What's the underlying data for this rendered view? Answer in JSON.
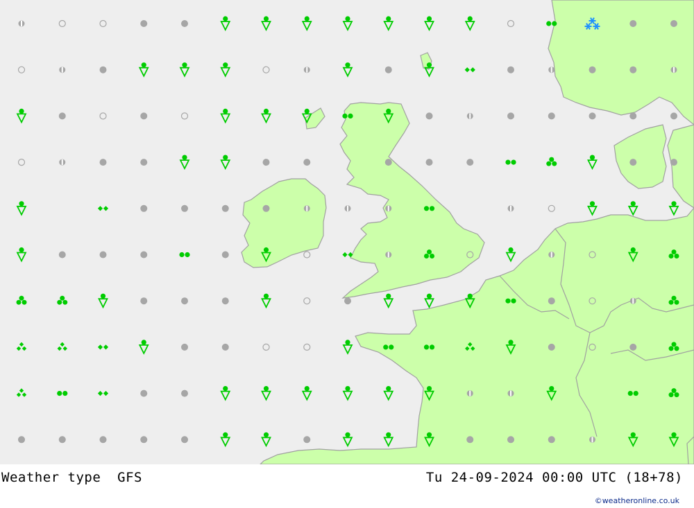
{
  "header": {
    "title": "Weather type",
    "model": "GFS",
    "datetime": "Tu 24-09-2024 00:00 UTC (18+78)",
    "credit": "©weatheronline.co.uk"
  },
  "colors": {
    "sea": "#eeeeee",
    "land": "#ccffaa",
    "coast": "#a0a0a0",
    "cloud": "#a6a6a6",
    "rain": "#00cc00",
    "snow": "#1e90ff"
  },
  "legend_symbols": {
    "clear": "empty circle",
    "partly": "half-filled circle",
    "overcast": "filled grey circle",
    "rain2": "two green dots",
    "rain3": "three green dots (triangle)",
    "drizzle": "two green diamonds",
    "drizzle3": "three green diamonds",
    "shower": "green dot over triangle",
    "snow": "three blue asterisks"
  },
  "grid": {
    "rows": [
      [
        "partly",
        "clear",
        "clear",
        "overcast",
        "overcast",
        "shower",
        "shower",
        "shower",
        "shower",
        "shower",
        "shower",
        "shower",
        "clear",
        "rain2",
        "snow",
        "overcast",
        "overcast"
      ],
      [
        "clear",
        "partly",
        "overcast",
        "shower",
        "shower",
        "shower",
        "clear",
        "partly",
        "shower",
        "overcast",
        "shower",
        "drizzle",
        "overcast",
        "partly",
        "overcast",
        "overcast",
        "partly"
      ],
      [
        "shower",
        "overcast",
        "clear",
        "overcast",
        "clear",
        "shower",
        "shower",
        "shower",
        "rain2",
        "shower",
        "overcast",
        "partly",
        "overcast",
        "overcast",
        "overcast",
        "overcast",
        "overcast"
      ],
      [
        "clear",
        "partly",
        "overcast",
        "overcast",
        "shower",
        "shower",
        "overcast",
        "overcast",
        "none",
        "overcast",
        "overcast",
        "overcast",
        "rain2",
        "rain3",
        "shower",
        "overcast",
        "overcast"
      ],
      [
        "shower",
        "none",
        "drizzle",
        "overcast",
        "overcast",
        "overcast",
        "overcast",
        "partly",
        "partly",
        "partly",
        "rain2",
        "none",
        "partly",
        "clear",
        "shower",
        "shower",
        "shower"
      ],
      [
        "shower",
        "overcast",
        "overcast",
        "overcast",
        "rain2",
        "overcast",
        "shower",
        "clear",
        "drizzle",
        "partly",
        "rain3",
        "clear",
        "shower",
        "partly",
        "clear",
        "shower",
        "rain3"
      ],
      [
        "rain3",
        "rain3",
        "shower",
        "overcast",
        "overcast",
        "overcast",
        "shower",
        "clear",
        "overcast",
        "shower",
        "shower",
        "shower",
        "rain2",
        "overcast",
        "clear",
        "partly",
        "rain3"
      ],
      [
        "drizzle3",
        "drizzle3",
        "drizzle",
        "shower",
        "overcast",
        "overcast",
        "clear",
        "clear",
        "shower",
        "rain2",
        "rain2",
        "drizzle3",
        "shower",
        "overcast",
        "clear",
        "overcast",
        "rain3"
      ],
      [
        "drizzle3",
        "rain2",
        "drizzle",
        "overcast",
        "overcast",
        "shower",
        "shower",
        "shower",
        "shower",
        "shower",
        "shower",
        "partly",
        "partly",
        "shower",
        "none",
        "rain2",
        "rain3"
      ],
      [
        "overcast",
        "overcast",
        "overcast",
        "overcast",
        "overcast",
        "shower",
        "shower",
        "overcast",
        "shower",
        "shower",
        "shower",
        "overcast",
        "overcast",
        "overcast",
        "partly",
        "shower",
        "shower"
      ]
    ]
  }
}
